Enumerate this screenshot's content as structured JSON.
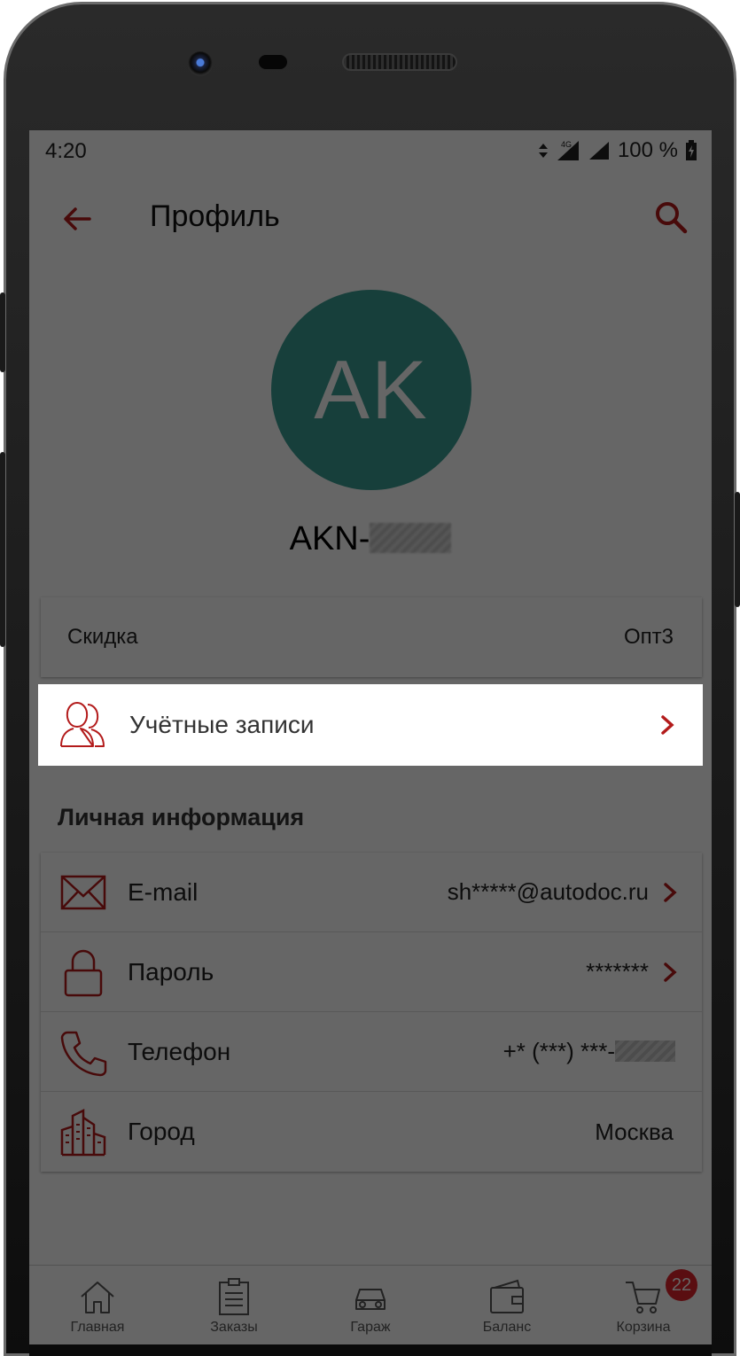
{
  "status_bar": {
    "time": "4:20",
    "network": "4G",
    "battery": "100 %"
  },
  "app_bar": {
    "title": "Профиль"
  },
  "profile": {
    "initials": "AK",
    "username_prefix": "AKN-"
  },
  "discount": {
    "label": "Скидка",
    "value": "Опт3"
  },
  "accounts": {
    "label": "Учётные записи"
  },
  "personal_section": {
    "title": "Личная информация"
  },
  "personal_rows": [
    {
      "label": "E-mail",
      "value": "sh*****@autodoc.ru",
      "icon": "mail-icon"
    },
    {
      "label": "Пароль",
      "value": "*******",
      "icon": "lock-icon"
    },
    {
      "label": "Телефон",
      "value": "+* (***) ***-",
      "icon": "phone-icon"
    },
    {
      "label": "Город",
      "value": "Москва",
      "icon": "city-icon"
    }
  ],
  "bottom_nav": [
    {
      "label": "Главная",
      "icon": "home-icon"
    },
    {
      "label": "Заказы",
      "icon": "orders-icon"
    },
    {
      "label": "Гараж",
      "icon": "car-icon"
    },
    {
      "label": "Баланс",
      "icon": "wallet-icon"
    },
    {
      "label": "Корзина",
      "icon": "cart-icon",
      "badge": "22"
    }
  ],
  "colors": {
    "accent": "#b31b1b",
    "avatar": "#3b9e93",
    "badge": "#e0242c"
  }
}
